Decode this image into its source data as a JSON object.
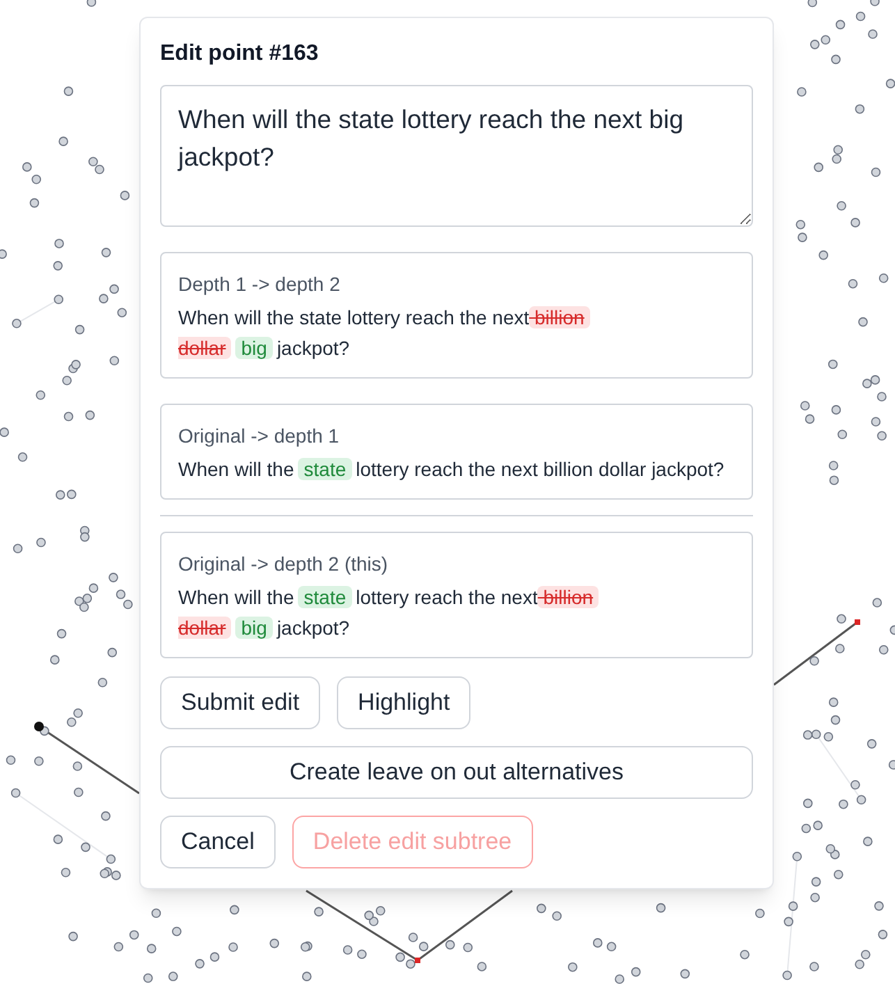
{
  "dialog": {
    "title": "Edit point #163",
    "text_value": "When will the state lottery reach the next big jackpot?",
    "diffs": [
      {
        "label": "Depth 1 -> depth 2",
        "segments": [
          {
            "kind": "plain",
            "text": "When will the state lottery reach the next"
          },
          {
            "kind": "removed",
            "text": " billion"
          },
          {
            "kind": "removed",
            "text": " dollar"
          },
          {
            "kind": "added",
            "text": "big"
          },
          {
            "kind": "plain",
            "text": "jackpot?"
          }
        ]
      },
      {
        "label": "Original -> depth 1",
        "segments": [
          {
            "kind": "plain",
            "text": "When will the"
          },
          {
            "kind": "added",
            "text": "state"
          },
          {
            "kind": "plain",
            "text": "lottery reach the next billion dollar jackpot?"
          }
        ]
      }
    ],
    "this_diff": {
      "label": "Original -> depth 2 (this)",
      "segments": [
        {
          "kind": "plain",
          "text": "When will the"
        },
        {
          "kind": "added",
          "text": "state"
        },
        {
          "kind": "plain",
          "text": "lottery reach the next"
        },
        {
          "kind": "removed",
          "text": " billion"
        },
        {
          "kind": "removed",
          "text": " dollar"
        },
        {
          "kind": "added",
          "text": "big"
        },
        {
          "kind": "plain",
          "text": "jackpot?"
        }
      ]
    },
    "button_rows": [
      [
        {
          "label": "Submit edit",
          "kind": "normal"
        },
        {
          "label": "Highlight",
          "kind": "normal"
        }
      ],
      [
        {
          "label": "Create leave on out alternatives",
          "kind": "wide"
        }
      ],
      [
        {
          "label": "Cancel",
          "kind": "normal"
        },
        {
          "label": "Delete edit subtree",
          "kind": "danger",
          "disabled": true
        }
      ]
    ]
  }
}
